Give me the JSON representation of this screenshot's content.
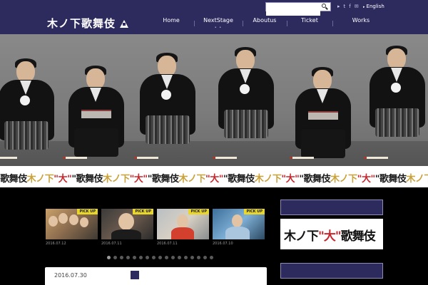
{
  "header": {
    "logo_text": "木ノ下歌舞伎",
    "search": {
      "placeholder": "",
      "icon": "search-icon"
    },
    "social": [
      "▸",
      "t",
      "f",
      "✉"
    ],
    "language_label": "English",
    "nav": [
      {
        "label": "Home"
      },
      {
        "label": "NextStage"
      },
      {
        "label": "Aboutus"
      },
      {
        "label": "Ticket"
      },
      {
        "label": "Works"
      }
    ],
    "colors": {
      "bar": "#2d2a5e",
      "divider": "#6b68a0"
    }
  },
  "strip": {
    "repeat_segments": [
      {
        "text": "\"歌舞伎",
        "tone": "blk"
      },
      {
        "text": "木ノ下",
        "tone": "gld"
      },
      {
        "text": "\"大\"",
        "tone": "red"
      }
    ],
    "colors": {
      "red": "#c8262c",
      "gold": "#c9a23a"
    }
  },
  "pickups": [
    {
      "badge": "PICK UP",
      "date": "2016.07.12"
    },
    {
      "badge": "PICK UP",
      "date": "2016.07.11"
    },
    {
      "badge": "PICK UP",
      "date": "2016.07.11"
    },
    {
      "badge": "PICK UP",
      "date": "2016.07.10"
    }
  ],
  "slider": {
    "total_dots": 17,
    "active_index": 0
  },
  "post": {
    "date": "2016.07.30"
  },
  "sidebar": {
    "banner": {
      "parts": [
        {
          "text": "木ノ下",
          "tone": "blk"
        },
        {
          "text": "\"大\"",
          "tone": "red"
        },
        {
          "text": "歌舞伎",
          "tone": "blk"
        }
      ]
    }
  }
}
